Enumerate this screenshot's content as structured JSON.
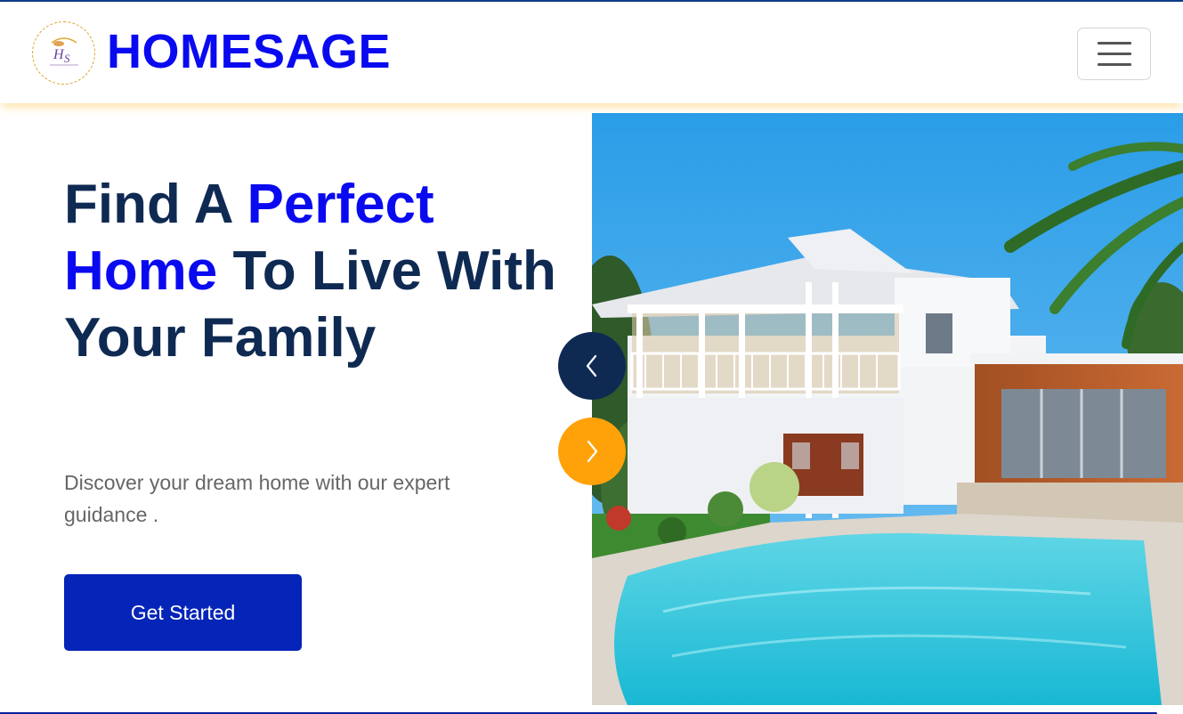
{
  "header": {
    "brand": "HOMESAGE",
    "logo_icon": "homesage-logo",
    "menu_icon": "hamburger-menu-icon"
  },
  "hero": {
    "title_part1": "Find A ",
    "title_accent": "Perfect Home",
    "title_part2": " To Live With Your Family",
    "subtitle": "Discover your dream home with our expert guidance .",
    "cta_label": "Get Started",
    "image_alt": "House with pool"
  },
  "carousel": {
    "prev_icon": "chevron-left-icon",
    "next_icon": "chevron-right-icon"
  },
  "colors": {
    "brand_blue": "#0a0af0",
    "heading_navy": "#0f2a52",
    "button_blue": "#0524b8",
    "accent_orange": "#ffa20a"
  }
}
